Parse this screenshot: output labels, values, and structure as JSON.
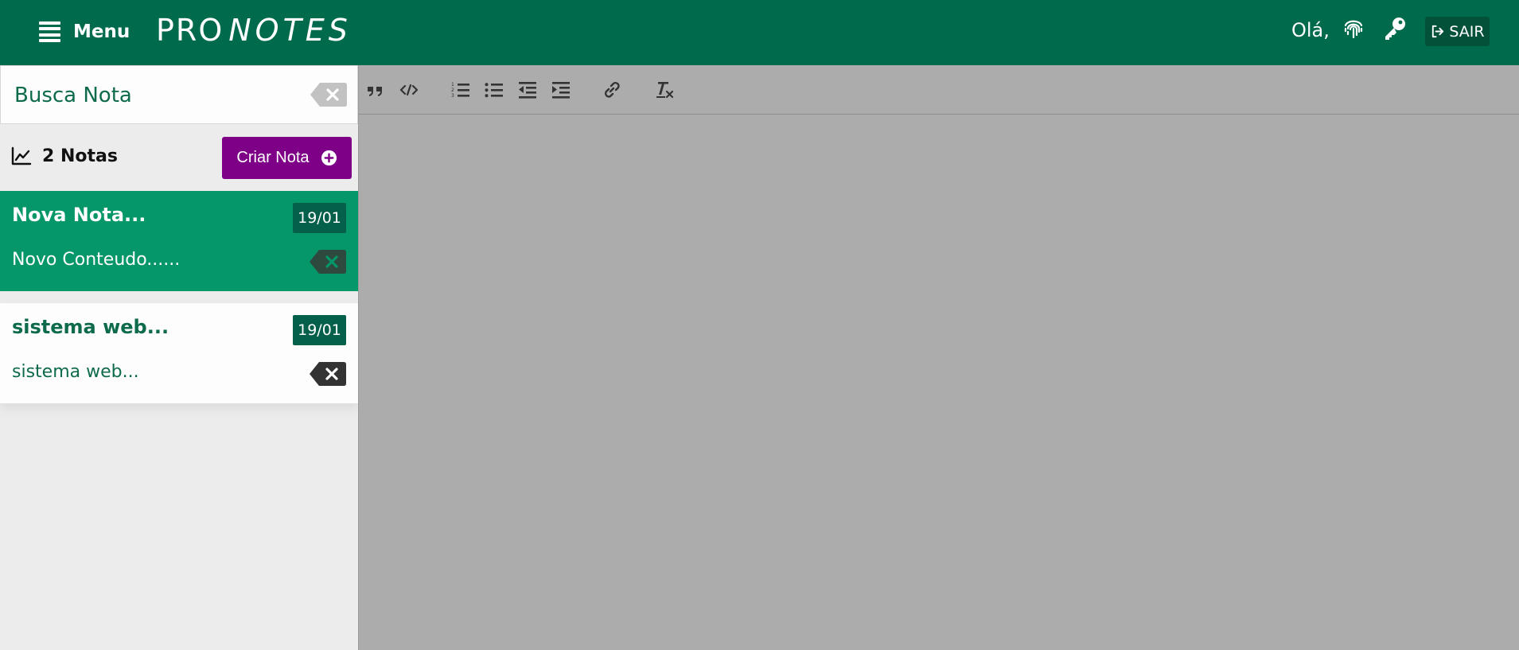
{
  "header": {
    "menu_label": "Menu",
    "logo_part1": "PRO",
    "logo_part2": "NOTES",
    "greeting": "Olá,",
    "logout_label": "SAIR"
  },
  "sidebar": {
    "search": {
      "placeholder": "Busca Nota",
      "value": ""
    },
    "count_label": "2 Notas",
    "create_label": "Criar Nota",
    "notes": [
      {
        "title": "Nova Nota...",
        "date": "19/01",
        "body": "Novo Conteudo......",
        "active": true
      },
      {
        "title": "sistema web...",
        "date": "19/01",
        "body": "sistema web...",
        "active": false
      }
    ]
  },
  "toolbar": {
    "buttons": [
      "blockquote-icon",
      "code-icon",
      "ordered-list-icon",
      "bullet-list-icon",
      "outdent-icon",
      "indent-icon",
      "link-icon",
      "clear-format-icon"
    ]
  },
  "colors": {
    "header_bg": "#006a4d",
    "active_note_bg": "#059669",
    "date_badge_bg": "#04604a",
    "create_button_bg": "#7e0087",
    "editor_bg": "#acacac"
  }
}
